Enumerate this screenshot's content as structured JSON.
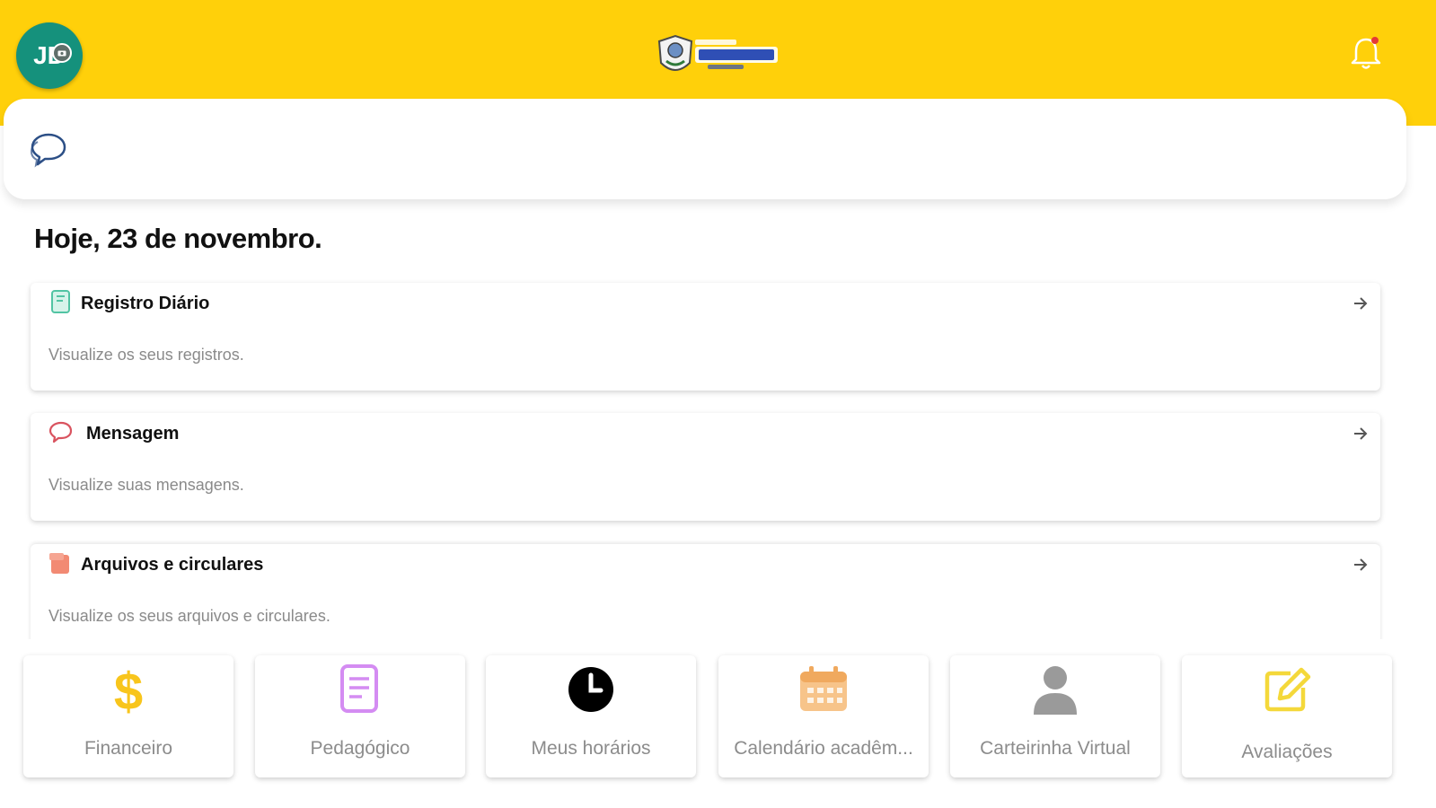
{
  "header": {
    "avatar_initials": "JD",
    "bg_color": "#ffd00a",
    "avatar_color": "#15917c",
    "logo_icon": "school-logo",
    "notification_icon": "bell-icon"
  },
  "chat_bar": {
    "icon": "chat-bubbles-icon"
  },
  "date_title": "Hoje, 23 de novembro.",
  "cards": [
    {
      "icon": "notebook-icon",
      "title": "Registro Diário",
      "description": "Visualize os seus registros."
    },
    {
      "icon": "chat-bubbles-icon",
      "title": "Mensagem",
      "description": "Visualize suas mensagens."
    },
    {
      "icon": "folder-icon",
      "title": "Arquivos e circulares",
      "description": "Visualize os seus arquivos e circulares."
    }
  ],
  "tiles": [
    {
      "icon": "dollar-icon",
      "label": "Financeiro",
      "color": "#f8c51c"
    },
    {
      "icon": "document-icon",
      "label": "Pedagógico",
      "color": "#d48cf2"
    },
    {
      "icon": "clock-icon",
      "label": "Meus horários",
      "color": "#000000"
    },
    {
      "icon": "calendar-icon",
      "label": "Calendário acadêm...",
      "color": "#f7c48a"
    },
    {
      "icon": "person-icon",
      "label": "Carteirinha Virtual",
      "color": "#9a9a9a"
    },
    {
      "icon": "edit-icon",
      "label": "Avaliações",
      "color": "#f4d83a"
    }
  ]
}
